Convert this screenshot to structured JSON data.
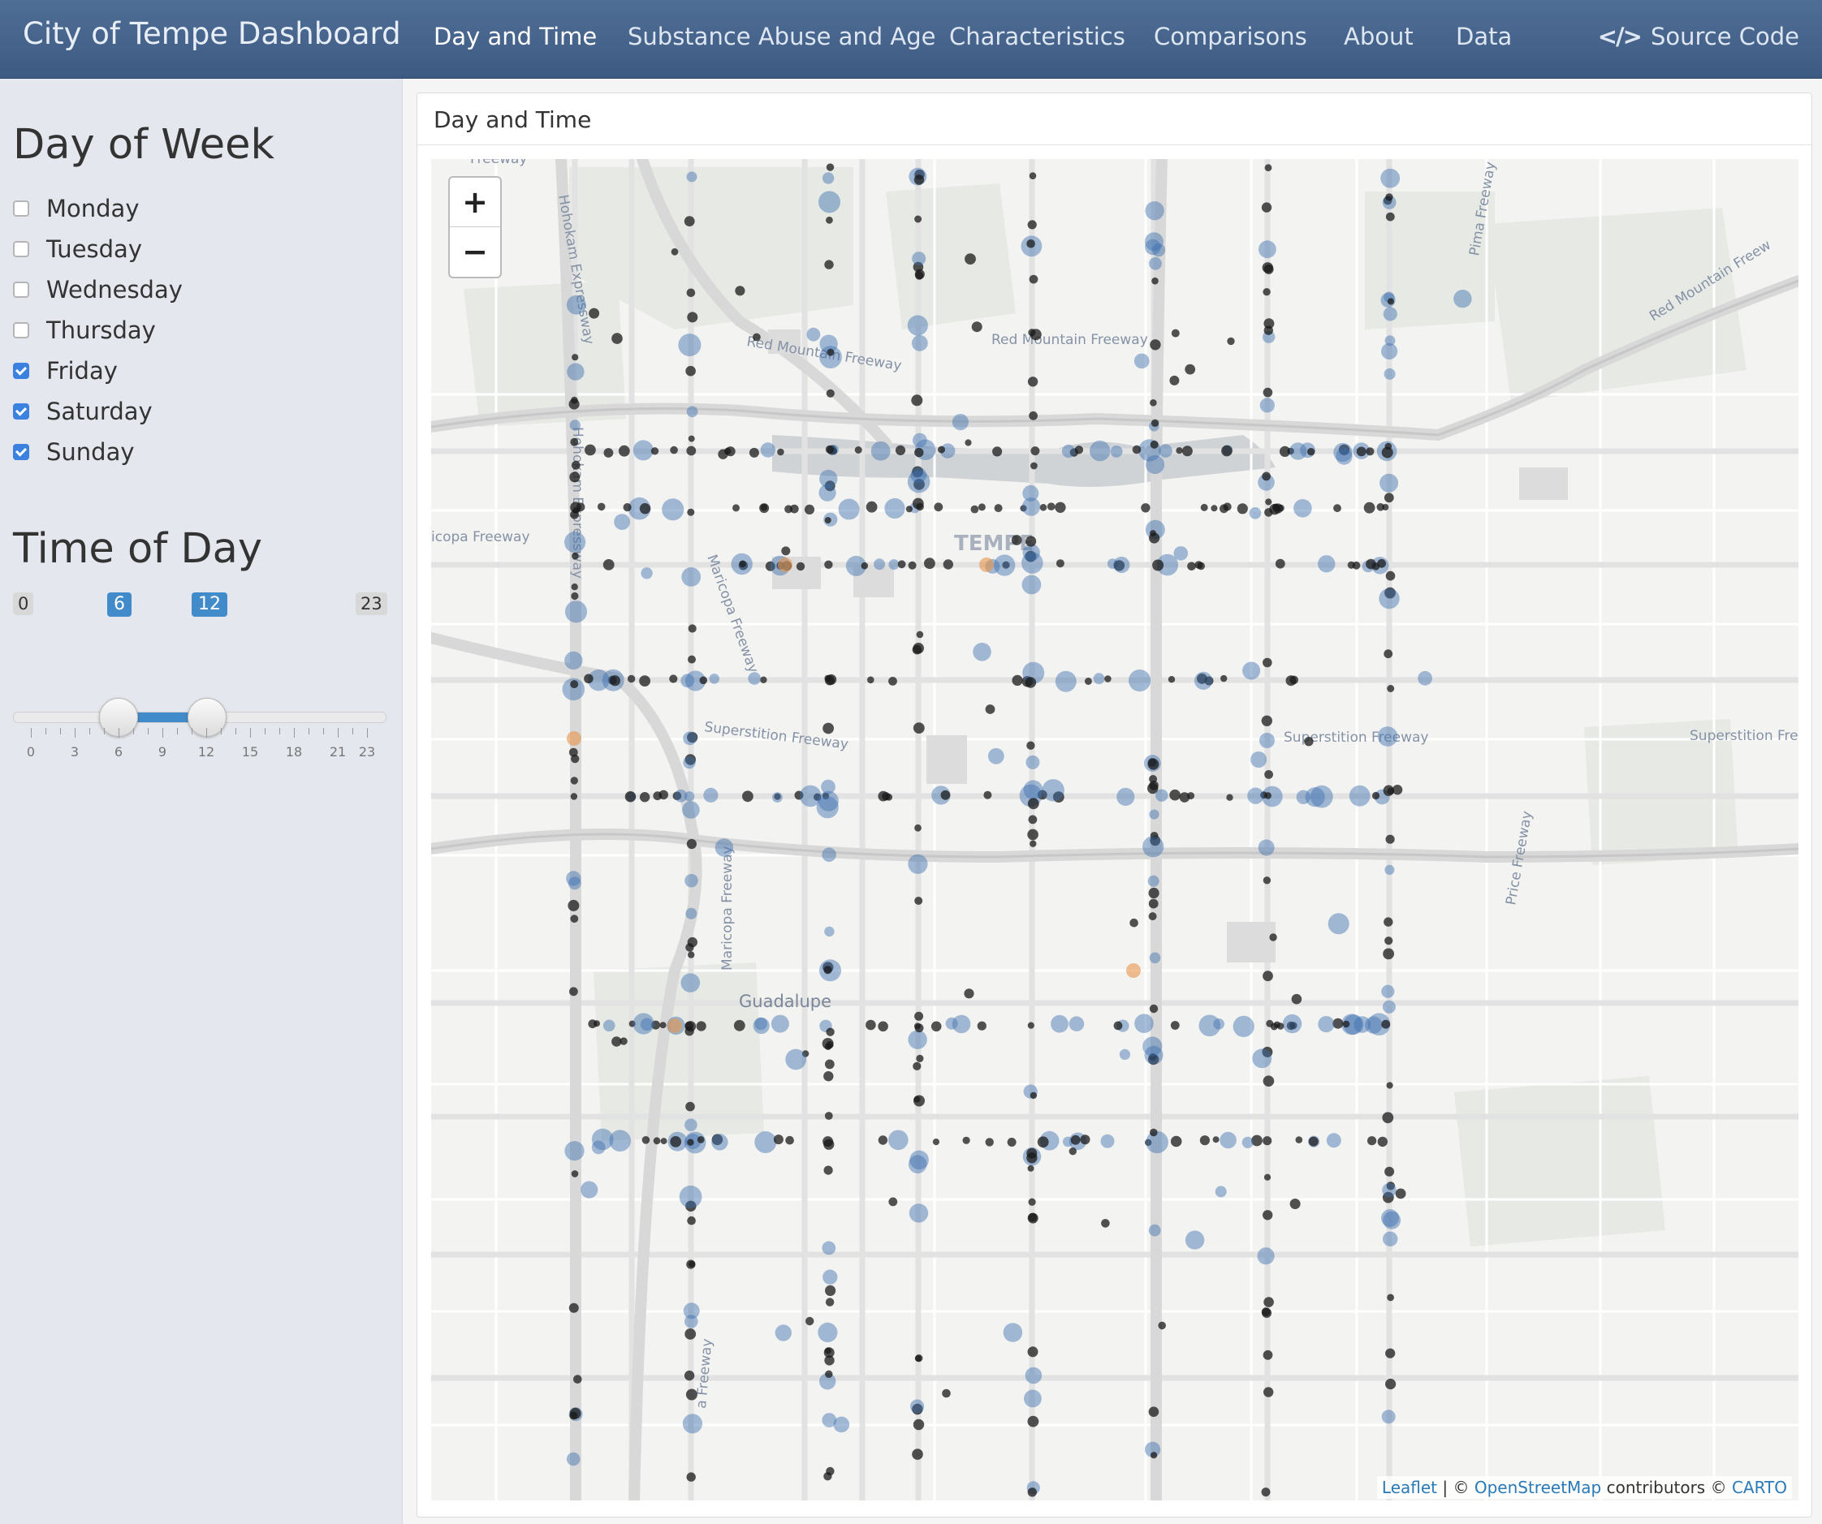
{
  "navbar": {
    "brand": "City of Tempe Dashboard",
    "tabs": [
      "Day and Time",
      "Substance Abuse and Age",
      "Characteristics",
      "Comparisons",
      "About",
      "Data"
    ],
    "active_tab": "Day and Time",
    "source_code": "Source Code",
    "source_icon": "code-icon"
  },
  "sidebar": {
    "day_heading": "Day of Week",
    "days": [
      {
        "label": "Monday",
        "checked": false
      },
      {
        "label": "Tuesday",
        "checked": false
      },
      {
        "label": "Wednesday",
        "checked": false
      },
      {
        "label": "Thursday",
        "checked": false
      },
      {
        "label": "Friday",
        "checked": true
      },
      {
        "label": "Saturday",
        "checked": true
      },
      {
        "label": "Sunday",
        "checked": true
      }
    ],
    "time_heading": "Time of Day",
    "slider": {
      "min": "0",
      "max": "23",
      "from": "6",
      "to": "12",
      "tick_labels": [
        "0",
        "3",
        "6",
        "9",
        "12",
        "15",
        "18",
        "21",
        "23"
      ]
    }
  },
  "panel": {
    "title": "Day and Time",
    "map": {
      "zoom_in": "+",
      "zoom_out": "−",
      "labels": {
        "tempe": "TEMPE",
        "guadalupe": "Guadalupe",
        "red_mountain_1": "Red Mountain Freeway",
        "red_mountain_2": "Red Mountain Freeway",
        "red_mountain_3": "Red Mountain Freew",
        "superstition_1": "Superstition Freeway",
        "superstition_2": "Superstition Freeway",
        "superstition_3": "Superstition Freewa",
        "maricopa_1": "icopa Freeway",
        "maricopa_2": "Maricopa Freeway",
        "maricopa_3": "Maricopa Freeway",
        "hohokam_1": "Hohokam Expressway",
        "hohokam_2": "Hohokam Expressway",
        "pima": "Pima Freeway",
        "price": "Price Freeway",
        "top_freeway": "Freeway",
        "bottom_freeway": "a Freeway"
      },
      "attribution": {
        "leaflet": "Leaflet",
        "sep": " | © ",
        "osm": "OpenStreetMap",
        "contrib": " contributors © ",
        "carto": "CARTO"
      },
      "colors": {
        "black": "#1a1a1a",
        "blue": "#3b6fb0",
        "orange": "#e8944a"
      }
    }
  }
}
